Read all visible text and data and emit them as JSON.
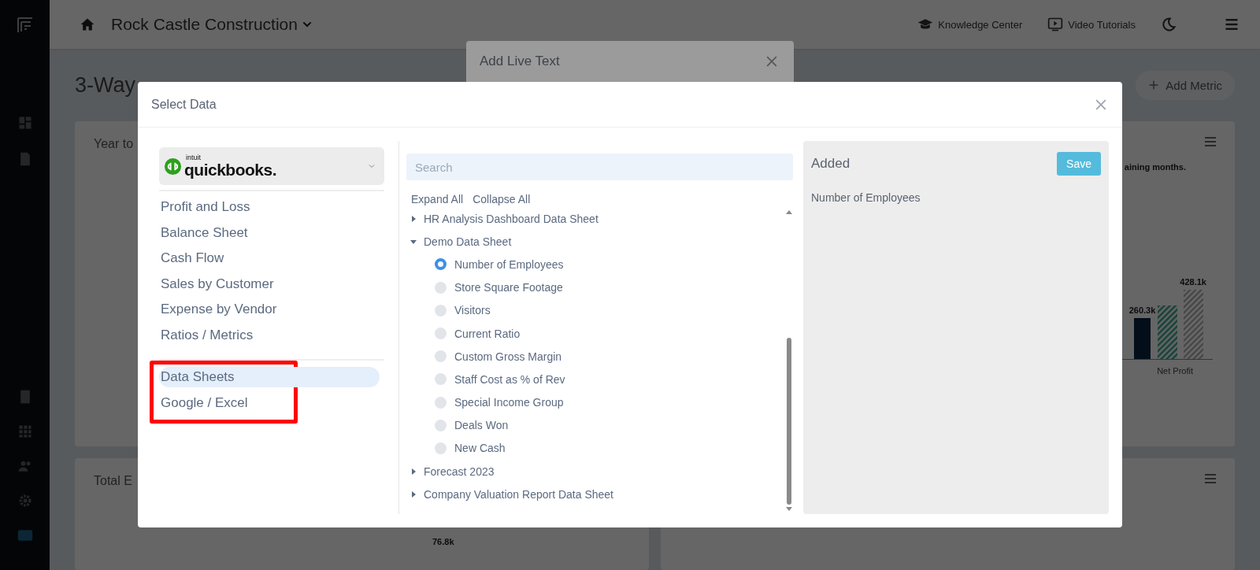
{
  "topbar": {
    "company": "Rock Castle Construction",
    "links": [
      "Knowledge Center",
      "Video Tutorials"
    ]
  },
  "page": {
    "title": "3-Way",
    "add_button": "Add Metric",
    "cards": [
      {
        "title": "Year to"
      },
      {
        "note": "aining months.",
        "bar_labels": [
          "260.3k",
          "428.1k"
        ],
        "category": "Net Profit"
      },
      {
        "title": "Total E",
        "bar_labels": [
          "76.8k"
        ]
      }
    ]
  },
  "back_dialog": {
    "title": "Add Live Text"
  },
  "dialog": {
    "title": "Select Data",
    "source": {
      "vendor": "intuit",
      "brand": "quickbooks."
    },
    "reports": [
      {
        "label": "Profit and Loss",
        "selected": false
      },
      {
        "label": "Balance Sheet",
        "selected": false
      },
      {
        "label": "Cash Flow",
        "selected": false
      },
      {
        "label": "Sales by Customer",
        "selected": false
      },
      {
        "label": "Expense by Vendor",
        "selected": false
      },
      {
        "label": "Ratios / Metrics",
        "selected": false
      }
    ],
    "sources": [
      {
        "label": "Data Sheets",
        "selected": true
      },
      {
        "label": "Google / Excel",
        "selected": false
      }
    ],
    "search": {
      "placeholder": "Search"
    },
    "tree_actions": [
      "Expand All",
      "Collapse All"
    ],
    "tree": [
      {
        "label": "HR Analysis Dashboard Data Sheet",
        "expanded": false
      },
      {
        "label": "Demo Data Sheet",
        "expanded": true,
        "children": [
          {
            "label": "Number of Employees",
            "selected": true
          },
          {
            "label": "Store Square Footage",
            "selected": false
          },
          {
            "label": "Visitors",
            "selected": false
          },
          {
            "label": "Current Ratio",
            "selected": false
          },
          {
            "label": "Custom Gross Margin",
            "selected": false
          },
          {
            "label": "Staff Cost as % of Rev",
            "selected": false
          },
          {
            "label": "Special Income Group",
            "selected": false
          },
          {
            "label": "Deals Won",
            "selected": false
          },
          {
            "label": "New Cash",
            "selected": false
          }
        ]
      },
      {
        "label": "Forecast 2023",
        "expanded": false
      },
      {
        "label": "Company Valuation Report Data Sheet",
        "expanded": false
      }
    ],
    "added": {
      "title": "Added",
      "save": "Save",
      "items": [
        "Number of Employees"
      ]
    }
  }
}
